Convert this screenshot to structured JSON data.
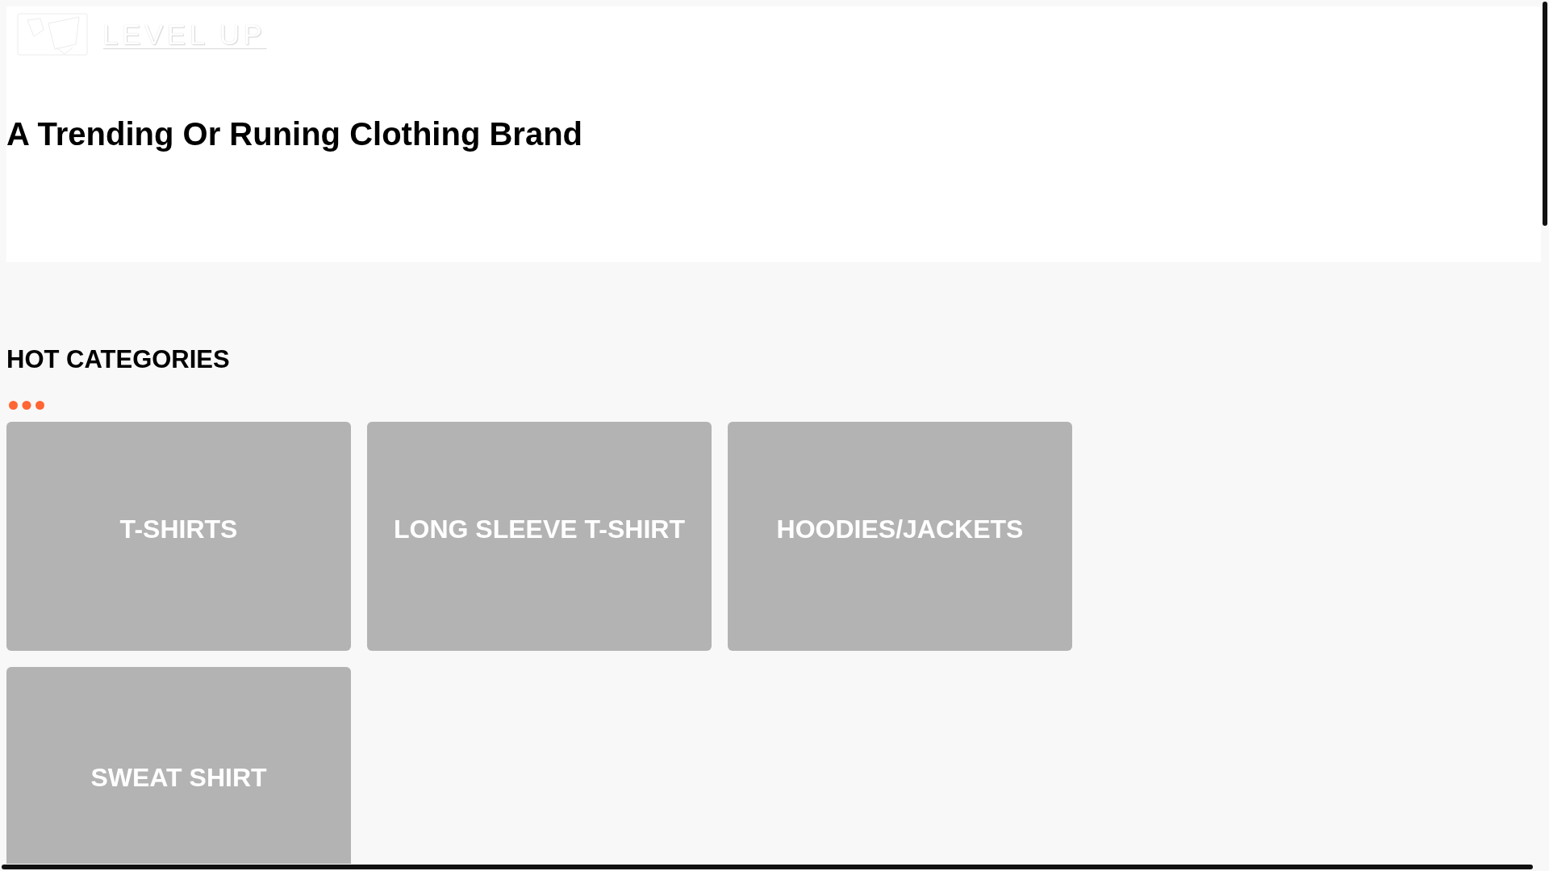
{
  "header": {
    "brand": "LEVEL UP",
    "headline": "A Trending Or Runing Clothing Brand"
  },
  "categories": {
    "title": "HOT CATEGORIES",
    "items": [
      {
        "label": "T-SHIRTS"
      },
      {
        "label": "LONG SLEEVE T-SHIRT"
      },
      {
        "label": "HOODIES/JACKETS"
      },
      {
        "label": "SWEAT SHIRT"
      }
    ]
  }
}
